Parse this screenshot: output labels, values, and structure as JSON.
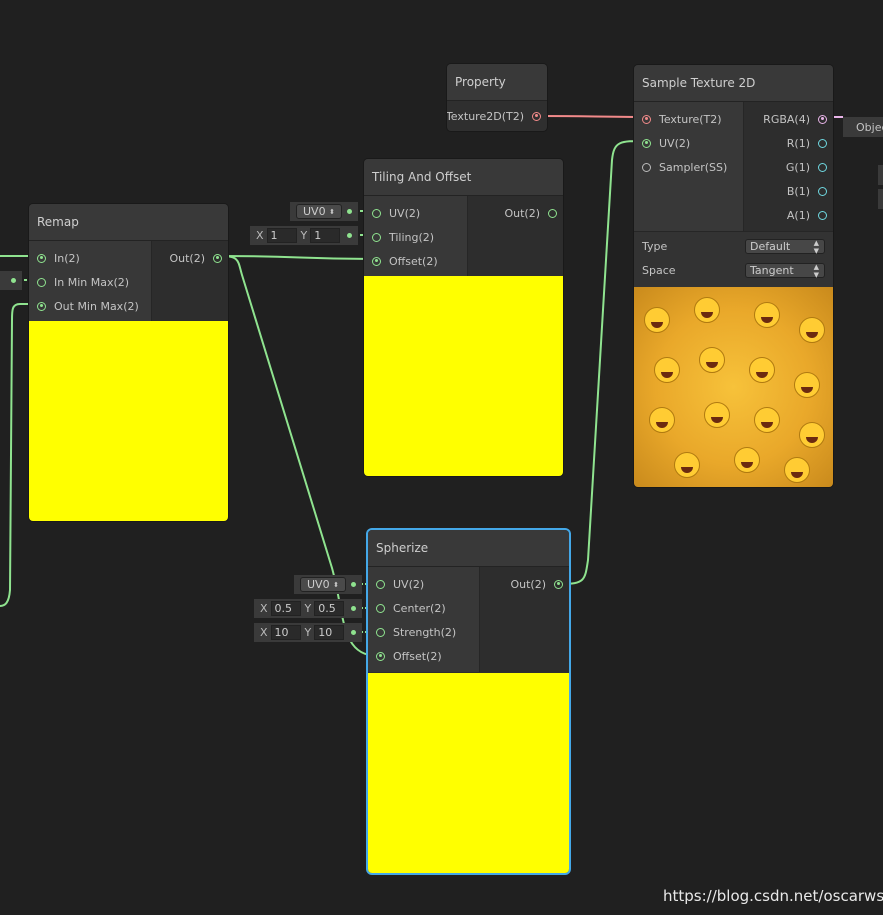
{
  "colors": {
    "vector2_wire": "#8fe38f",
    "texture_wire": "#f28a8a",
    "vector4_port": "#e8b4e8",
    "vector1_port": "#6fd8e0",
    "preview": "#ffff00",
    "selection": "#44a8e8",
    "background": "#202020"
  },
  "property": {
    "title": "Property",
    "output": "Texture2D(T2)"
  },
  "sample_texture": {
    "title": "Sample Texture 2D",
    "inputs": [
      "Texture(T2)",
      "UV(2)",
      "Sampler(SS)"
    ],
    "outputs": [
      "RGBA(4)",
      "R(1)",
      "G(1)",
      "B(1)",
      "A(1)"
    ],
    "type_label": "Type",
    "type_value": "Default",
    "space_label": "Space",
    "space_value": "Tangent"
  },
  "tiling": {
    "title": "Tiling And Offset",
    "inputs": [
      "UV(2)",
      "Tiling(2)",
      "Offset(2)"
    ],
    "output": "Out(2)",
    "uv_value": "UV0",
    "tiling_x_label": "X",
    "tiling_x": "1",
    "tiling_y_label": "Y",
    "tiling_y": "1"
  },
  "remap": {
    "title": "Remap",
    "inputs": [
      "In(2)",
      "In Min Max(2)",
      "Out Min Max(2)"
    ],
    "output": "Out(2)"
  },
  "spherize": {
    "title": "Spherize",
    "inputs": [
      "UV(2)",
      "Center(2)",
      "Strength(2)",
      "Offset(2)"
    ],
    "output": "Out(2)",
    "uv_value": "UV0",
    "center_x_label": "X",
    "center_x": "0.5",
    "center_y_label": "Y",
    "center_y": "0.5",
    "strength_x_label": "X",
    "strength_x": "10",
    "strength_y_label": "Y",
    "strength_y": "10"
  },
  "partial_node": {
    "label": "Objec"
  },
  "watermark": "https://blog.csdn.net/oscarwsd"
}
